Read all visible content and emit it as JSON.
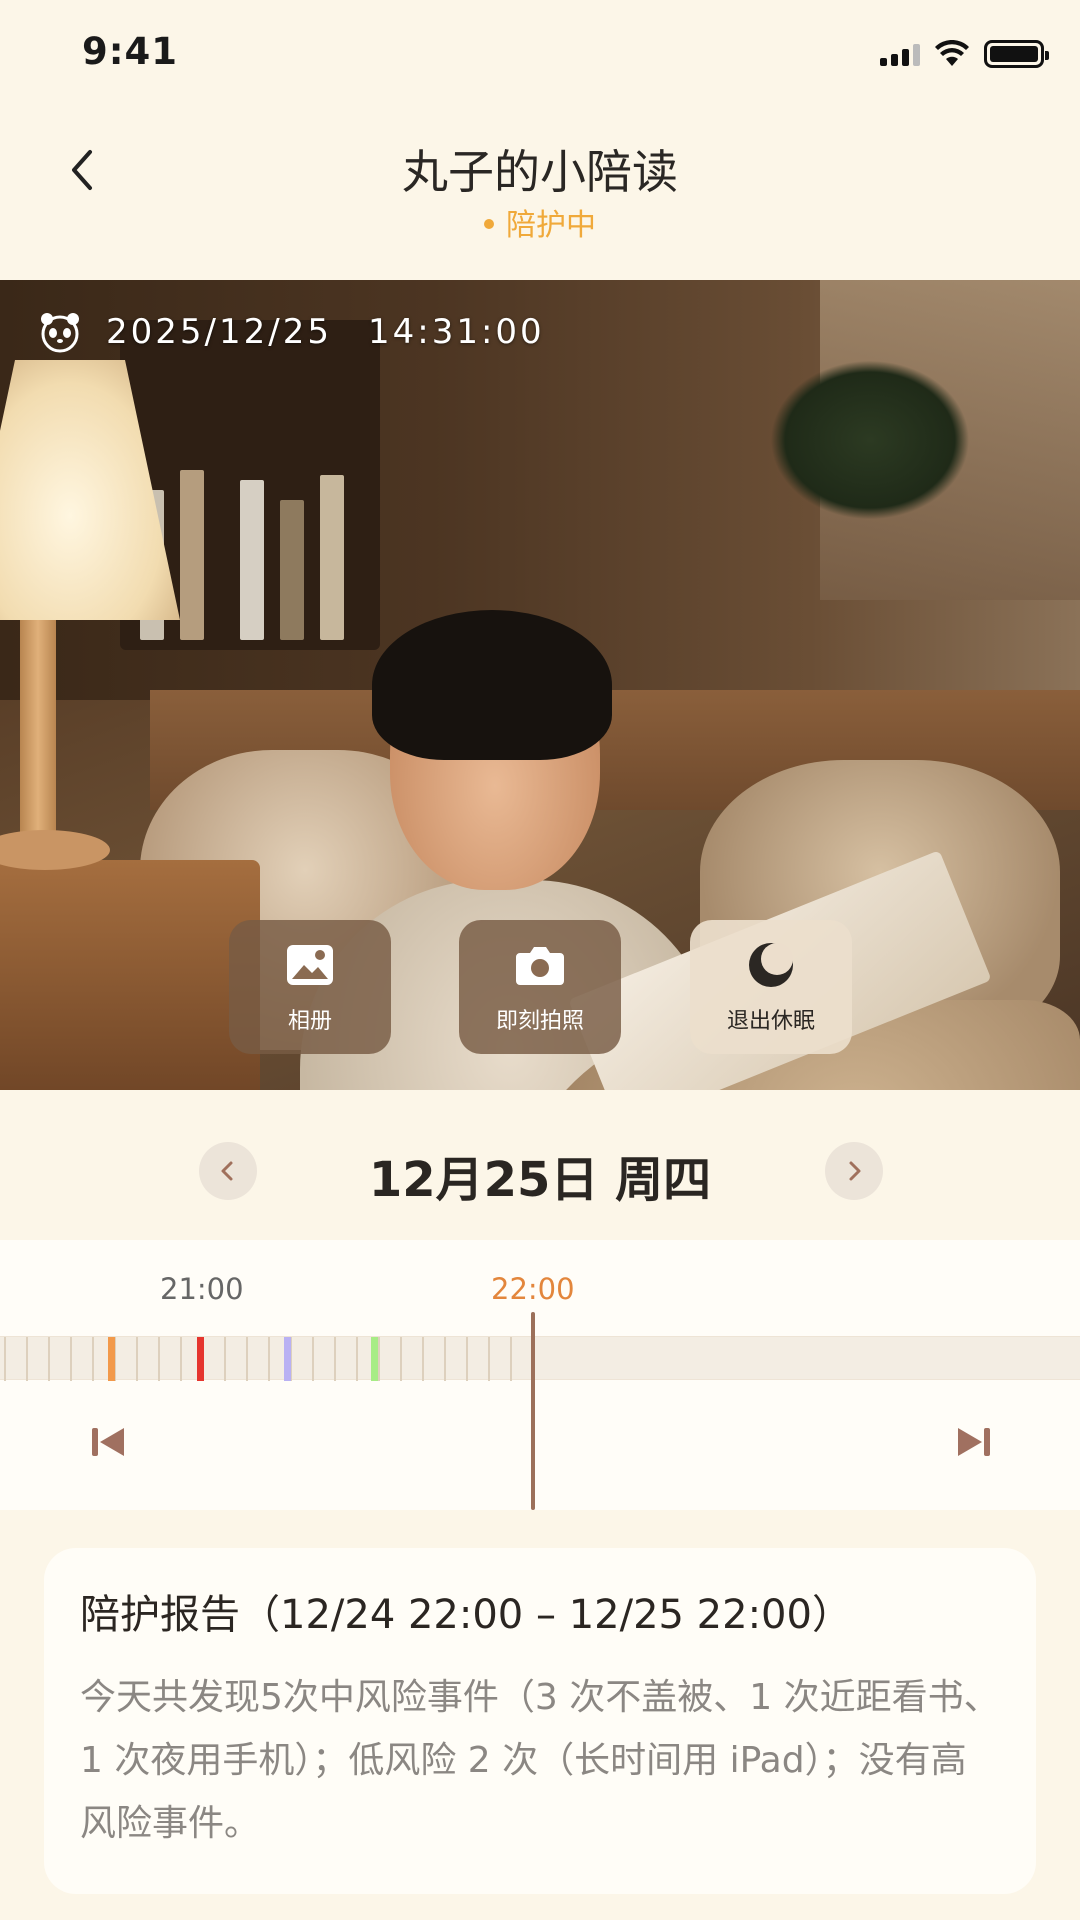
{
  "status_bar": {
    "time": "9:41"
  },
  "header": {
    "title": "丸子的小陪读",
    "status": "陪护中"
  },
  "camera": {
    "date": "2025/12/25",
    "time": "14:31:00",
    "actions": [
      {
        "label": "相册",
        "icon": "photo-album-icon"
      },
      {
        "label": "即刻拍照",
        "icon": "camera-icon"
      },
      {
        "label": "退出休眠",
        "icon": "moon-icon"
      }
    ]
  },
  "date_nav": {
    "label": "12月25日 周四"
  },
  "timeline": {
    "tick_labels": [
      "21:00",
      "22:00"
    ],
    "current_time": "22:00",
    "event_colors": [
      "#f2994a",
      "#e5352e",
      "#b9b1f3",
      "#a7ec86"
    ],
    "accent": "#e3863c",
    "playhead_color": "#9c705a"
  },
  "report": {
    "title": "陪护报告（12/24 22:00 – 12/25 22:00）",
    "body": "今天共发现5次中风险事件（3 次不盖被、1 次近距看书、1 次夜用手机）；低风险 2 次（长时间用 iPad）；没有高风险事件。"
  },
  "colors": {
    "background": "#fcf6e8",
    "status_accent": "#f0a93a"
  }
}
